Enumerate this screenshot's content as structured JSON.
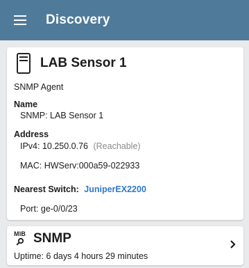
{
  "appbar": {
    "title": "Discovery"
  },
  "device": {
    "name": "LAB Sensor 1",
    "type": "SNMP Agent",
    "name_label": "Name",
    "snmp_line": "SNMP:  LAB Sensor 1",
    "address_label": "Address",
    "ipv4_line": "IPv4:  10.250.0.76",
    "reachable": "(Reachable)",
    "mac_line": "MAC:  HWServ:000a59-022933",
    "nearest_switch_label": "Nearest Switch:",
    "nearest_switch_value": "JuniperEX2200",
    "port_line": "Port:  ge-0/0/23"
  },
  "snmp_card": {
    "icon_text": "MIB",
    "title": "SNMP",
    "uptime": "Uptime:  6 days 4 hours 29 minutes"
  },
  "colors": {
    "appbar": "#4f7a99",
    "background": "#e9eaec",
    "link": "#2f78c8",
    "muted": "#8a8a8a"
  },
  "icons": [
    "hamburger-menu-icon",
    "server-device-icon",
    "mib-search-icon",
    "chevron-right-icon"
  ]
}
